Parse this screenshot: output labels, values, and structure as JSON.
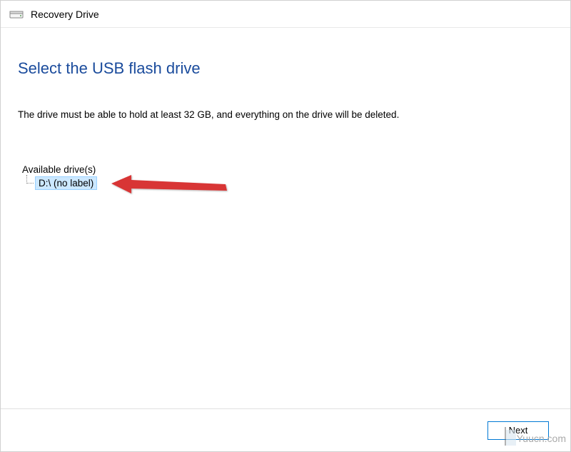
{
  "titleBar": {
    "title": "Recovery Drive"
  },
  "main": {
    "heading": "Select the USB flash drive",
    "description": "The drive must be able to hold at least 32 GB, and everything on the drive will be deleted.",
    "drivesLabel": "Available drive(s)",
    "drives": [
      {
        "label": "D:\\ (no label)"
      }
    ]
  },
  "buttons": {
    "next": "Next"
  },
  "watermark": "Yuucn.com"
}
